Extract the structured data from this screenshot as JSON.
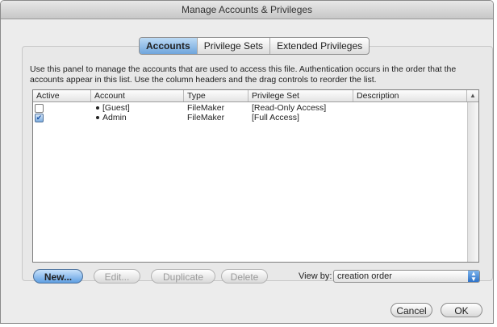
{
  "window": {
    "title": "Manage Accounts & Privileges"
  },
  "tabs": [
    {
      "label": "Accounts",
      "selected": true
    },
    {
      "label": "Privilege Sets",
      "selected": false
    },
    {
      "label": "Extended Privileges",
      "selected": false
    }
  ],
  "description": {
    "line1": "Use this panel to manage the accounts that are used to access this file.  Authentication occurs in the order that the",
    "line2": "accounts appear in this list.  Use the column headers and the drag controls to reorder the list."
  },
  "table": {
    "columns": [
      "Active",
      "Account",
      "Type",
      "Privilege Set",
      "Description"
    ],
    "sort_icon": "triangle-up-icon",
    "rows": [
      {
        "active": false,
        "account": "[Guest]",
        "type": "FileMaker",
        "privilege_set": "[Read-Only Access]",
        "description": ""
      },
      {
        "active": true,
        "account": "Admin",
        "type": "FileMaker",
        "privilege_set": "[Full Access]",
        "description": ""
      }
    ]
  },
  "buttons": {
    "new": "New...",
    "edit": "Edit...",
    "duplicate": "Duplicate",
    "delete": "Delete",
    "cancel": "Cancel",
    "ok": "OK"
  },
  "view_by": {
    "label": "View by:",
    "selected": "creation order"
  },
  "colors": {
    "accent": "#6fa5dc",
    "default_button": "#5f9fe2"
  }
}
